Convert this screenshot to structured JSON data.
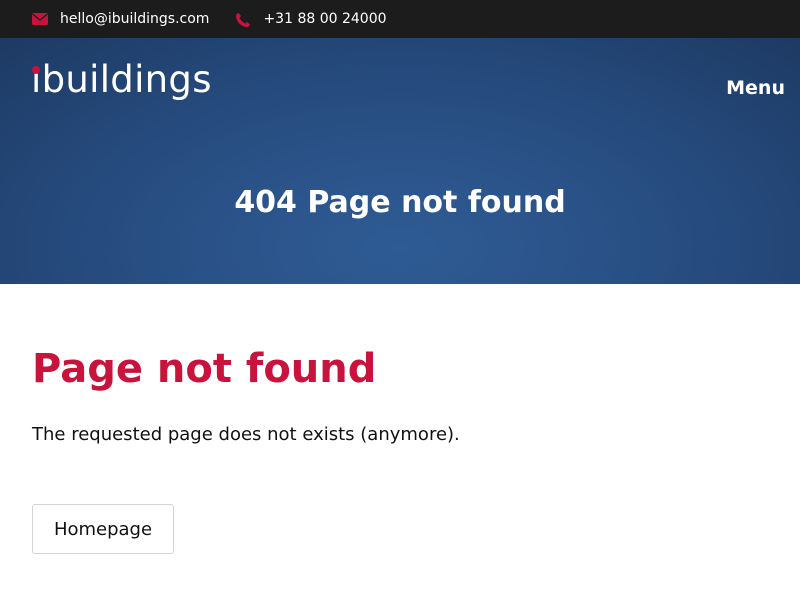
{
  "topbar": {
    "email": "hello@ibuildings.com",
    "phone": "+31 88 00 24000",
    "email_icon": "envelope-icon",
    "phone_icon": "phone-icon"
  },
  "header": {
    "logo_lead": "ı",
    "logo_rest": "buildings",
    "menu_label": "Menu",
    "hero_title": "404 Page not found"
  },
  "main": {
    "heading": "Page not found",
    "message": "The requested page does not exists (anymore).",
    "button_label": "Homepage"
  },
  "colors": {
    "accent": "#c8143c",
    "topbar_bg": "#1c1c1c",
    "hero_bg": "#2a5288"
  }
}
